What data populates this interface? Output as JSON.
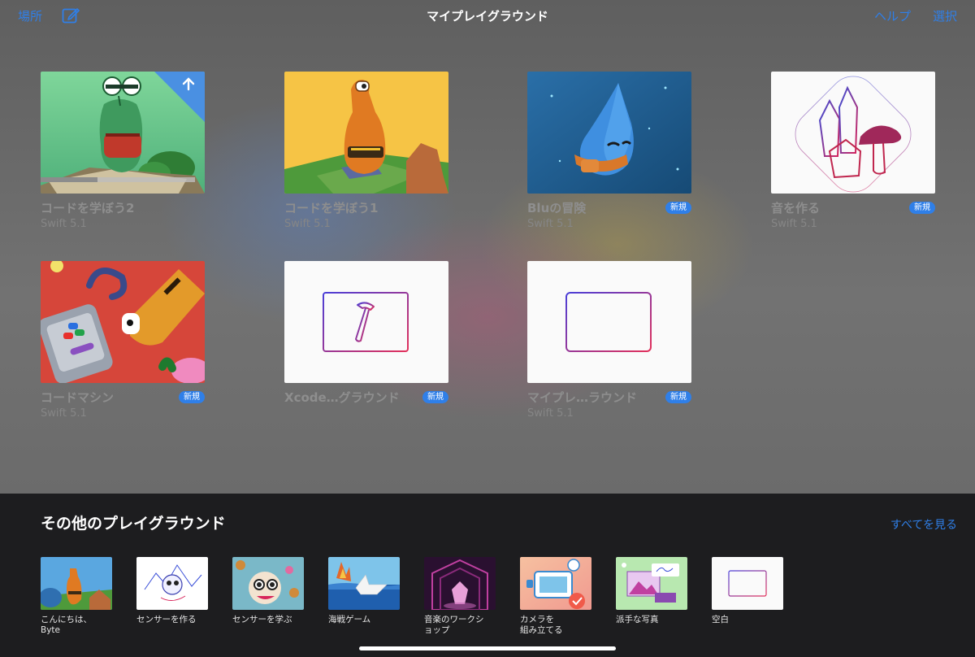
{
  "nav": {
    "locations": "場所",
    "title": "マイプレイグラウンド",
    "help": "ヘルプ",
    "select": "選択"
  },
  "colors": {
    "accent": "#2f7fe8",
    "bottom_bg": "#1d1d1f"
  },
  "cards": [
    {
      "name": "コードを学ぼう2",
      "version": "Swift 5.1",
      "badge": ""
    },
    {
      "name": "コードを学ぼう1",
      "version": "Swift 5.1",
      "badge": ""
    },
    {
      "name": "Bluの冒険",
      "version": "Swift 5.1",
      "badge": "新規"
    },
    {
      "name": "音を作る",
      "version": "Swift 5.1",
      "badge": "新規"
    },
    {
      "name": "コードマシン",
      "version": "Swift 5.1",
      "badge": "新規"
    },
    {
      "name": "Xcode…グラウンド",
      "version": "",
      "badge": "新規"
    },
    {
      "name": "マイプレ…ラウンド",
      "version": "Swift 5.1",
      "badge": "新規"
    }
  ],
  "more": {
    "title": "その他のプレイグラウンド",
    "see_all": "すべてを見る",
    "items": [
      {
        "label": "こんにちは、\nByte"
      },
      {
        "label": "センサーを作る"
      },
      {
        "label": "センサーを学ぶ"
      },
      {
        "label": "海戦ゲーム"
      },
      {
        "label": "音楽のワークシ\nョップ"
      },
      {
        "label": "カメラを\n組み立てる"
      },
      {
        "label": "派手な写真"
      },
      {
        "label": "空白"
      }
    ]
  }
}
